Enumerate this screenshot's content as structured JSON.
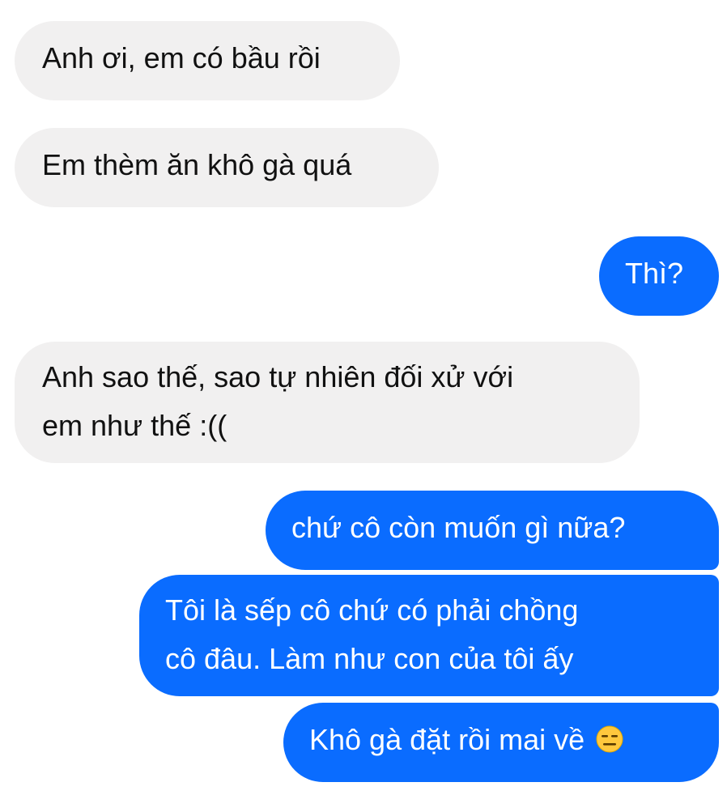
{
  "conversation": {
    "messages": [
      {
        "sender": "them",
        "lines": [
          "Anh ơi, em có bầu rồi"
        ]
      },
      {
        "sender": "them",
        "lines": [
          "Em thèm ăn khô gà quá"
        ]
      },
      {
        "sender": "me",
        "lines": [
          "Thì?"
        ]
      },
      {
        "sender": "them",
        "lines": [
          "Anh sao thế, sao tự nhiên đối xử với",
          "em như thế :(("
        ]
      },
      {
        "sender": "me",
        "lines": [
          "chứ cô còn muốn gì nữa?"
        ]
      },
      {
        "sender": "me",
        "lines": [
          "Tôi là sếp cô chứ có phải chồng",
          "cô đâu. Làm như con của tôi ấy"
        ]
      },
      {
        "sender": "me",
        "lines": [
          "Khô gà đặt rồi mai về"
        ],
        "emoji": "expressionless-face-icon"
      }
    ]
  },
  "colors": {
    "incoming_bubble": "#f1f0f0",
    "outgoing_bubble": "#0a6cff",
    "incoming_text": "#111111",
    "outgoing_text": "#ffffff"
  }
}
